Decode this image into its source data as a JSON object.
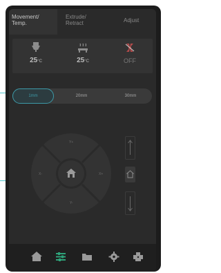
{
  "tabs": [
    {
      "label_line1": "Movement/",
      "label_line2": "Temp.",
      "active": true
    },
    {
      "label_line1": "Extrude/",
      "label_line2": "Retract",
      "active": false
    },
    {
      "label_line1": "Adjust",
      "label_line2": "",
      "active": false
    }
  ],
  "temperatures": {
    "nozzle": {
      "value": "25",
      "unit": "°C",
      "icon": "nozzle-icon"
    },
    "bed": {
      "value": "25",
      "unit": "°C",
      "icon": "heated-bed-icon"
    },
    "fan": {
      "value": "OFF",
      "icon": "fan-off-icon"
    }
  },
  "distance": {
    "options": [
      "1mm",
      "20mm",
      "30mm"
    ],
    "selected_index": 0
  },
  "jog": {
    "y_plus": "Y+",
    "y_minus": "Y-",
    "x_plus": "X+",
    "x_minus": "X-",
    "home_icon": "home-icon"
  },
  "z_axis": {
    "up_label": "Z+",
    "down_label": "Z-",
    "home_icon": "z-home-icon"
  },
  "nav": {
    "items": [
      {
        "name": "home",
        "icon": "home-icon"
      },
      {
        "name": "movement",
        "icon": "sliders-icon",
        "active": true
      },
      {
        "name": "files",
        "icon": "folder-icon"
      },
      {
        "name": "settings",
        "icon": "gear-icon"
      },
      {
        "name": "printer",
        "icon": "printer-icon"
      }
    ]
  },
  "colors": {
    "accent": "#3d9aa8",
    "nav_active": "#2ea37a",
    "fan_off": "#b04a4a",
    "panel": "#333333",
    "background": "#2a2a2a"
  }
}
